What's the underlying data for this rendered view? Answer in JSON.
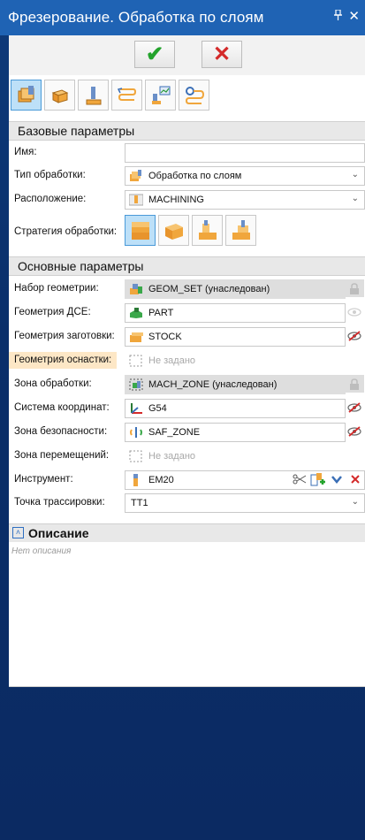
{
  "window": {
    "title": "Фрезерование. Обработка по слоям",
    "pin_glyph": " ̈",
    "close_glyph": "✕"
  },
  "actions": {
    "ok_glyph": "✔",
    "cancel_glyph": "✕"
  },
  "toolbar": {
    "icons": [
      "layer-milling-icon",
      "part-block-icon",
      "tool-icon",
      "toolpath-icon",
      "strategy-chart-icon",
      "trace-icon"
    ],
    "active_index": 0
  },
  "basic": {
    "header": "Базовые параметры",
    "name_label": "Имя:",
    "name_value": "",
    "type_label": "Тип обработки:",
    "type_value": "Обработка по слоям",
    "location_label": "Расположение:",
    "location_value": "MACHINING",
    "strategy_label": "Стратегия обработки:"
  },
  "main": {
    "header": "Основные параметры",
    "rows": [
      {
        "label": "Набор геометрии:",
        "value": "GEOM_SET (унаследован)"
      },
      {
        "label": "Геометрия ДСЕ:",
        "value": "PART"
      },
      {
        "label": "Геометрия заготовки:",
        "value": "STOCK"
      },
      {
        "label": "Геометрия оснастки:",
        "value": "Не задано"
      },
      {
        "label": "Зона обработки:",
        "value": "MACH_ZONE (унаследован)"
      },
      {
        "label": "Система координат:",
        "value": "G54"
      },
      {
        "label": "Зона безопасности:",
        "value": "SAF_ZONE"
      },
      {
        "label": "Зона перемещений:",
        "value": "Не задано"
      },
      {
        "label": "Инструмент:",
        "value": "EM20"
      },
      {
        "label": "Точка трассировки:",
        "value": "TT1"
      }
    ]
  },
  "description": {
    "header": "Описание",
    "placeholder": "Нет описания"
  },
  "colors": {
    "title_bar": "#1f63b4",
    "background": "#0b2f6a",
    "ok": "#23a32c",
    "cancel": "#d42a2a",
    "warn_label": "#fde7c6"
  }
}
